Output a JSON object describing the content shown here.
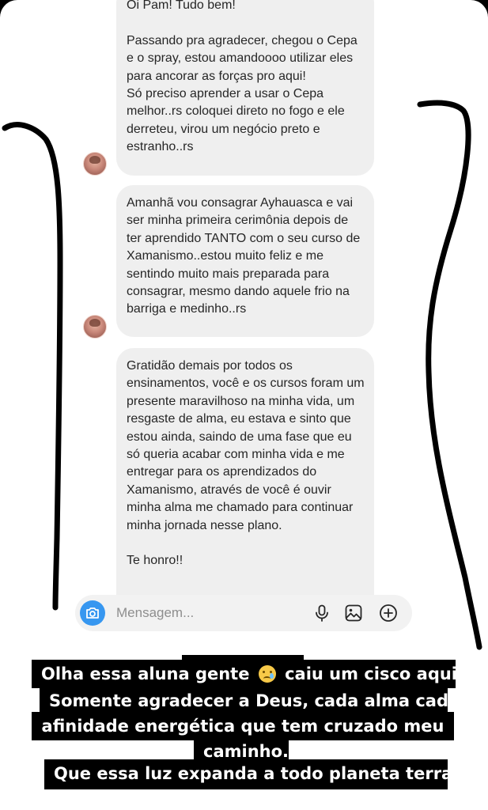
{
  "messages": [
    {
      "text": "Oi Pam! Tudo bem!\n\nPassando pra agradecer, chegou o Cepa e o spray, estou amandoooo utilizar eles para ancorar as forças pro aqui!\nSó preciso aprender a usar o Cepa melhor..rs coloquei direto no fogo e ele derreteu, virou um negócio preto e estranho..rs"
    },
    {
      "text": "Amanhã vou consagrar Ayhauasca e vai ser minha primeira cerimônia depois de ter aprendido TANTO com o seu curso de Xamanismo..estou muito feliz e me sentindo muito mais preparada para consagrar, mesmo dando aquele frio na barriga e medinho..rs"
    },
    {
      "text": "Gratidão demais por todos os ensinamentos, você e os cursos foram um presente maravilhoso na minha vida, um resgaste de alma, eu estava e sinto que estou ainda, saindo de uma fase que eu só queria acabar com minha vida e me entregar para os aprendizados do Xamanismo, através de você é ouvir minha alma me chamado para continuar minha jornada nesse plano.\n\nTe honro!!"
    }
  ],
  "composer": {
    "placeholder": "Mensagem...",
    "camera_icon": "camera-icon",
    "mic_icon": "microphone-icon",
    "gallery_icon": "image-icon",
    "plus_icon": "plus-circle-icon",
    "accent": "#3797f0"
  },
  "caption": {
    "line1_before": "Olha essa aluna gente",
    "line1_emoji": "crying-face-emoji",
    "line1_after": "caiu um cisco aqui.",
    "line2": "Somente agradecer a Deus, cada alma cada",
    "line3": "afinidade energética que tem cruzado meu",
    "line4": "caminho.",
    "line5": "Que essa luz expanda a todo planeta terra."
  }
}
